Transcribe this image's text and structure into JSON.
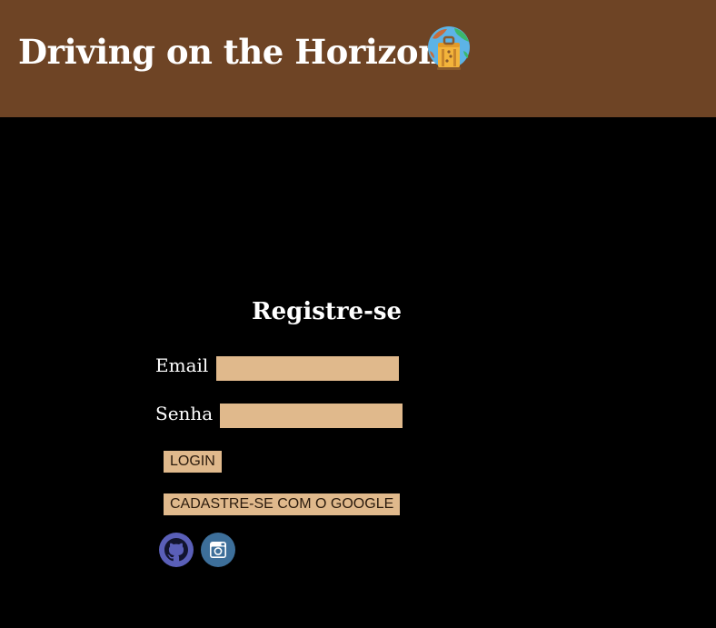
{
  "header": {
    "title": "Driving on the Horizon",
    "icon": "globe-luggage-icon",
    "background": "#6e4425"
  },
  "form": {
    "title": "Registre-se",
    "email_label": "Email",
    "password_label": "Senha",
    "email_value": "",
    "password_value": "",
    "login_button": "LOGIN",
    "google_button": "CADASTRE-SE COM O GOOGLE",
    "field_color": "#e0b98c"
  },
  "social": {
    "items": [
      {
        "icon": "github-icon"
      },
      {
        "icon": "instagram-icon"
      }
    ]
  }
}
